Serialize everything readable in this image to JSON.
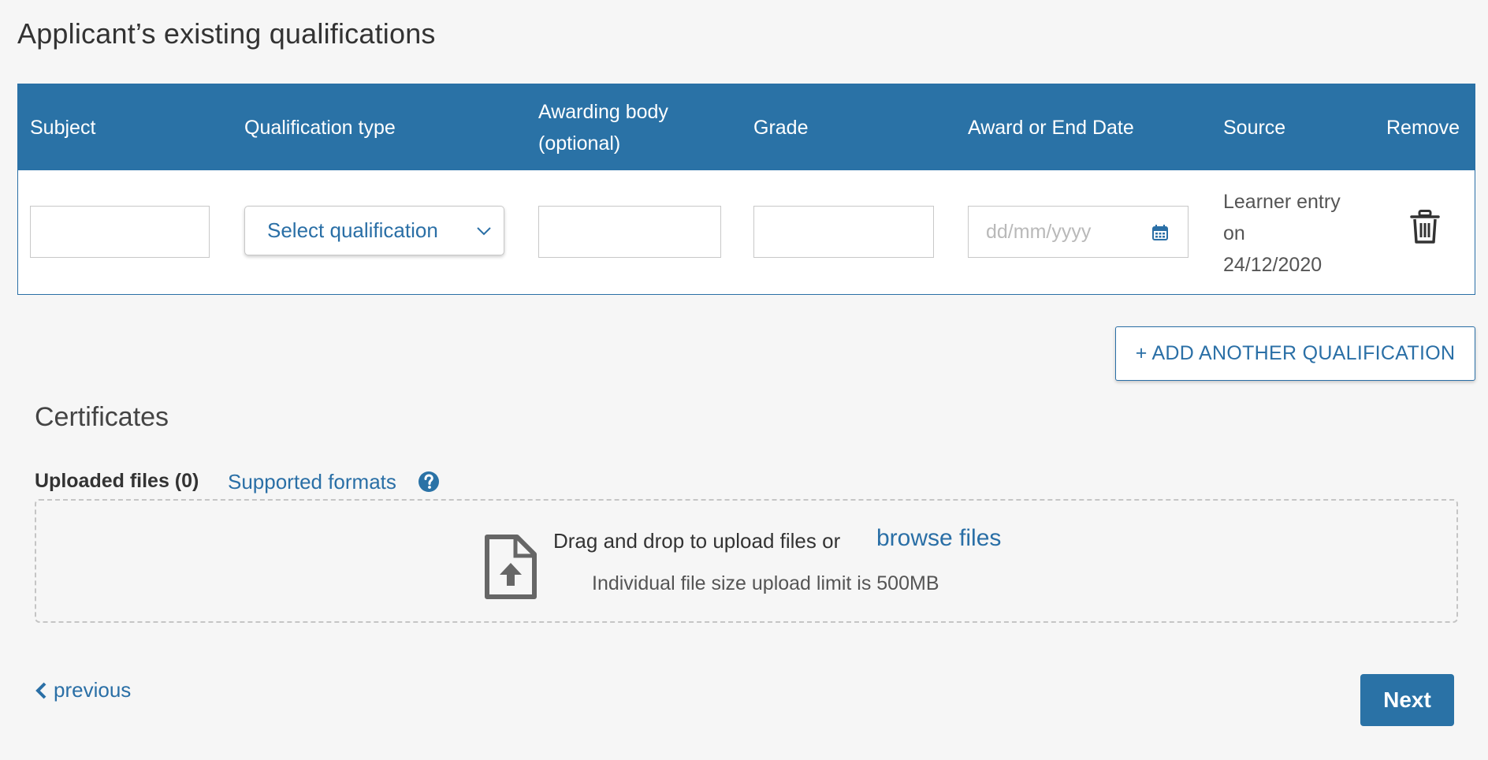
{
  "page": {
    "title": "Applicant’s existing qualifications"
  },
  "table": {
    "headers": {
      "subject": "Subject",
      "qualification_type": "Qualification type",
      "awarding_body_line1": "Awarding body",
      "awarding_body_line2": "(optional)",
      "grade": "Grade",
      "award_date": "Award or End Date",
      "source": "Source",
      "remove": "Remove"
    },
    "row": {
      "subject_value": "",
      "qualification_select": "Select qualification",
      "awarding_body_value": "",
      "grade_value": "",
      "date_placeholder": "dd/mm/yyyy",
      "source_line1": "Learner entry",
      "source_line2": "on",
      "source_line3": "24/12/2020"
    }
  },
  "add_button": {
    "label": "+ ADD ANOTHER QUALIFICATION"
  },
  "certificates": {
    "heading": "Certificates",
    "uploaded_label": "Uploaded files (0)",
    "supported_formats_link": "Supported formats",
    "drop_text": "Drag and drop to upload files or",
    "browse_link": "browse files",
    "limit_text": "Individual file size upload limit is 500MB"
  },
  "nav": {
    "previous_label": "previous",
    "next_label": "Next"
  },
  "colors": {
    "accent": "#2a72a6",
    "background": "#f6f6f6"
  },
  "icons": {
    "select_chevron": "chevron-down-icon",
    "date": "calendar-icon",
    "remove": "trash-icon",
    "help": "question-circle-icon",
    "upload": "file-upload-icon",
    "previous": "chevron-left-icon"
  }
}
